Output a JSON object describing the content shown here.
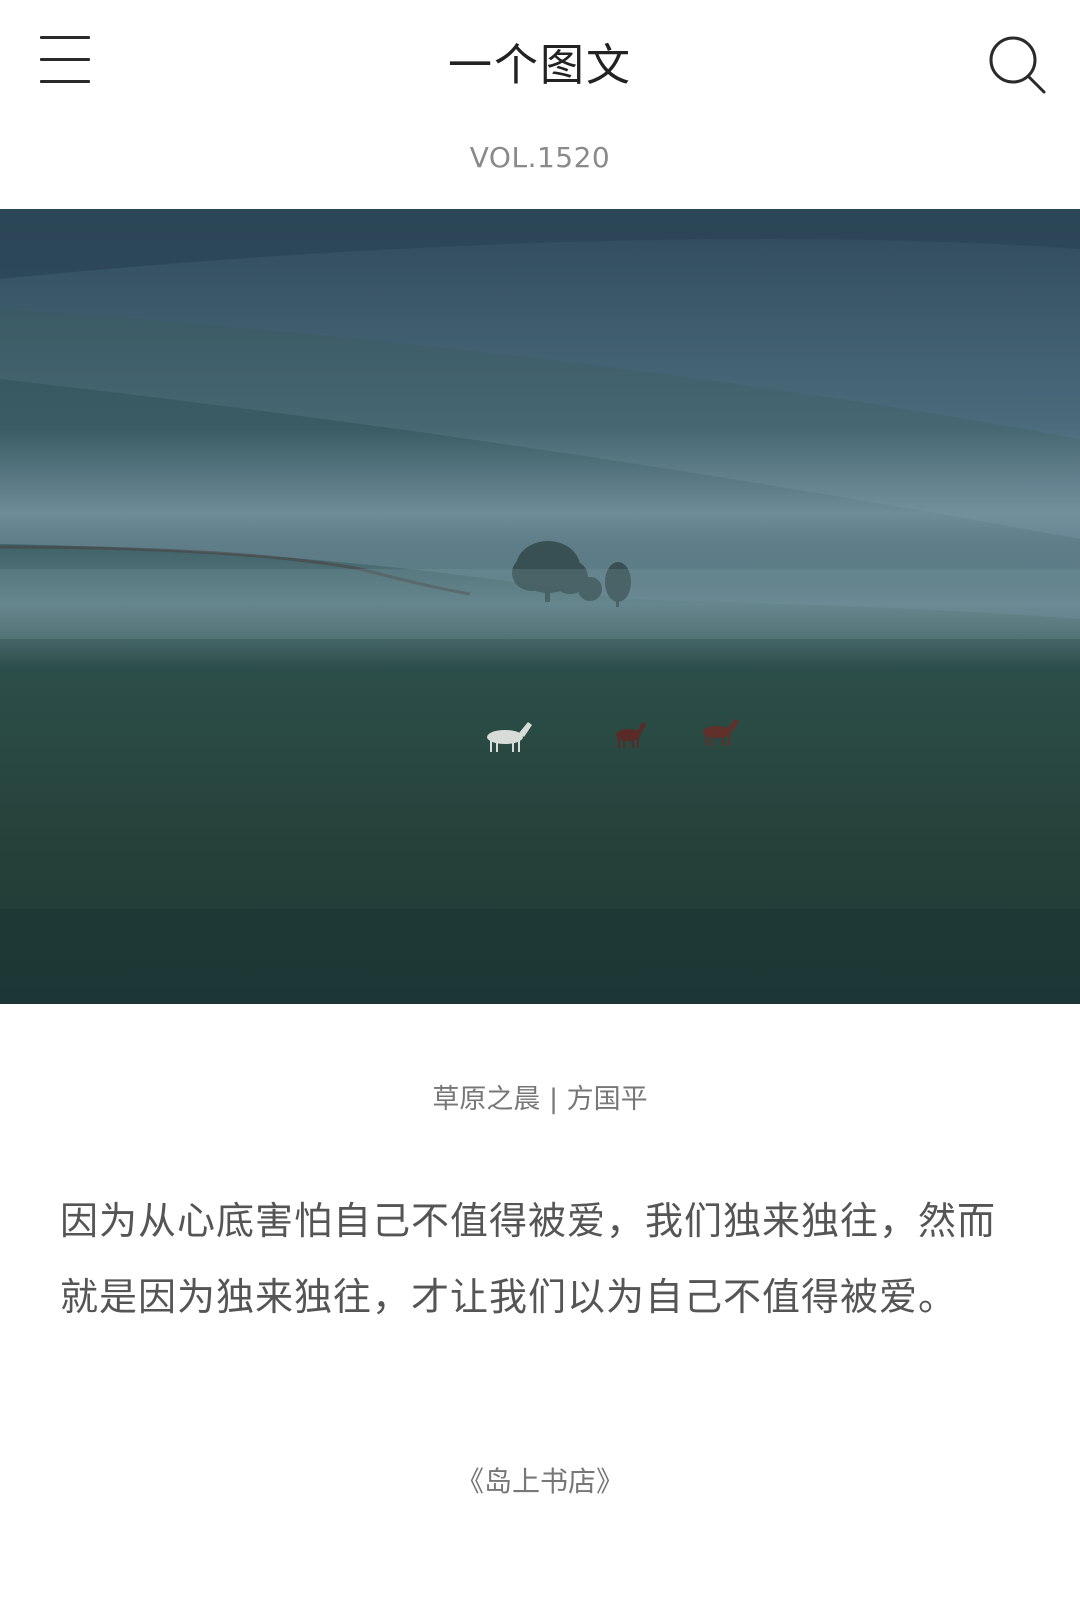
{
  "header": {
    "title": "一个图文",
    "menu_icon": "menu-icon",
    "search_icon": "search-icon"
  },
  "volume": "VOL.1520",
  "photo": {
    "subject": "misty-grassland-with-horses"
  },
  "caption": "草原之晨 | 方国平",
  "quote": "因为从心底害怕自己不值得被爱，我们独来独往，然而就是因为独来独往，才让我们以为自己不值得被爱。",
  "source": "《岛上书店》",
  "colors": {
    "title": "#222222",
    "muted": "#8a8a8a",
    "body": "#555555",
    "background": "#ffffff"
  }
}
